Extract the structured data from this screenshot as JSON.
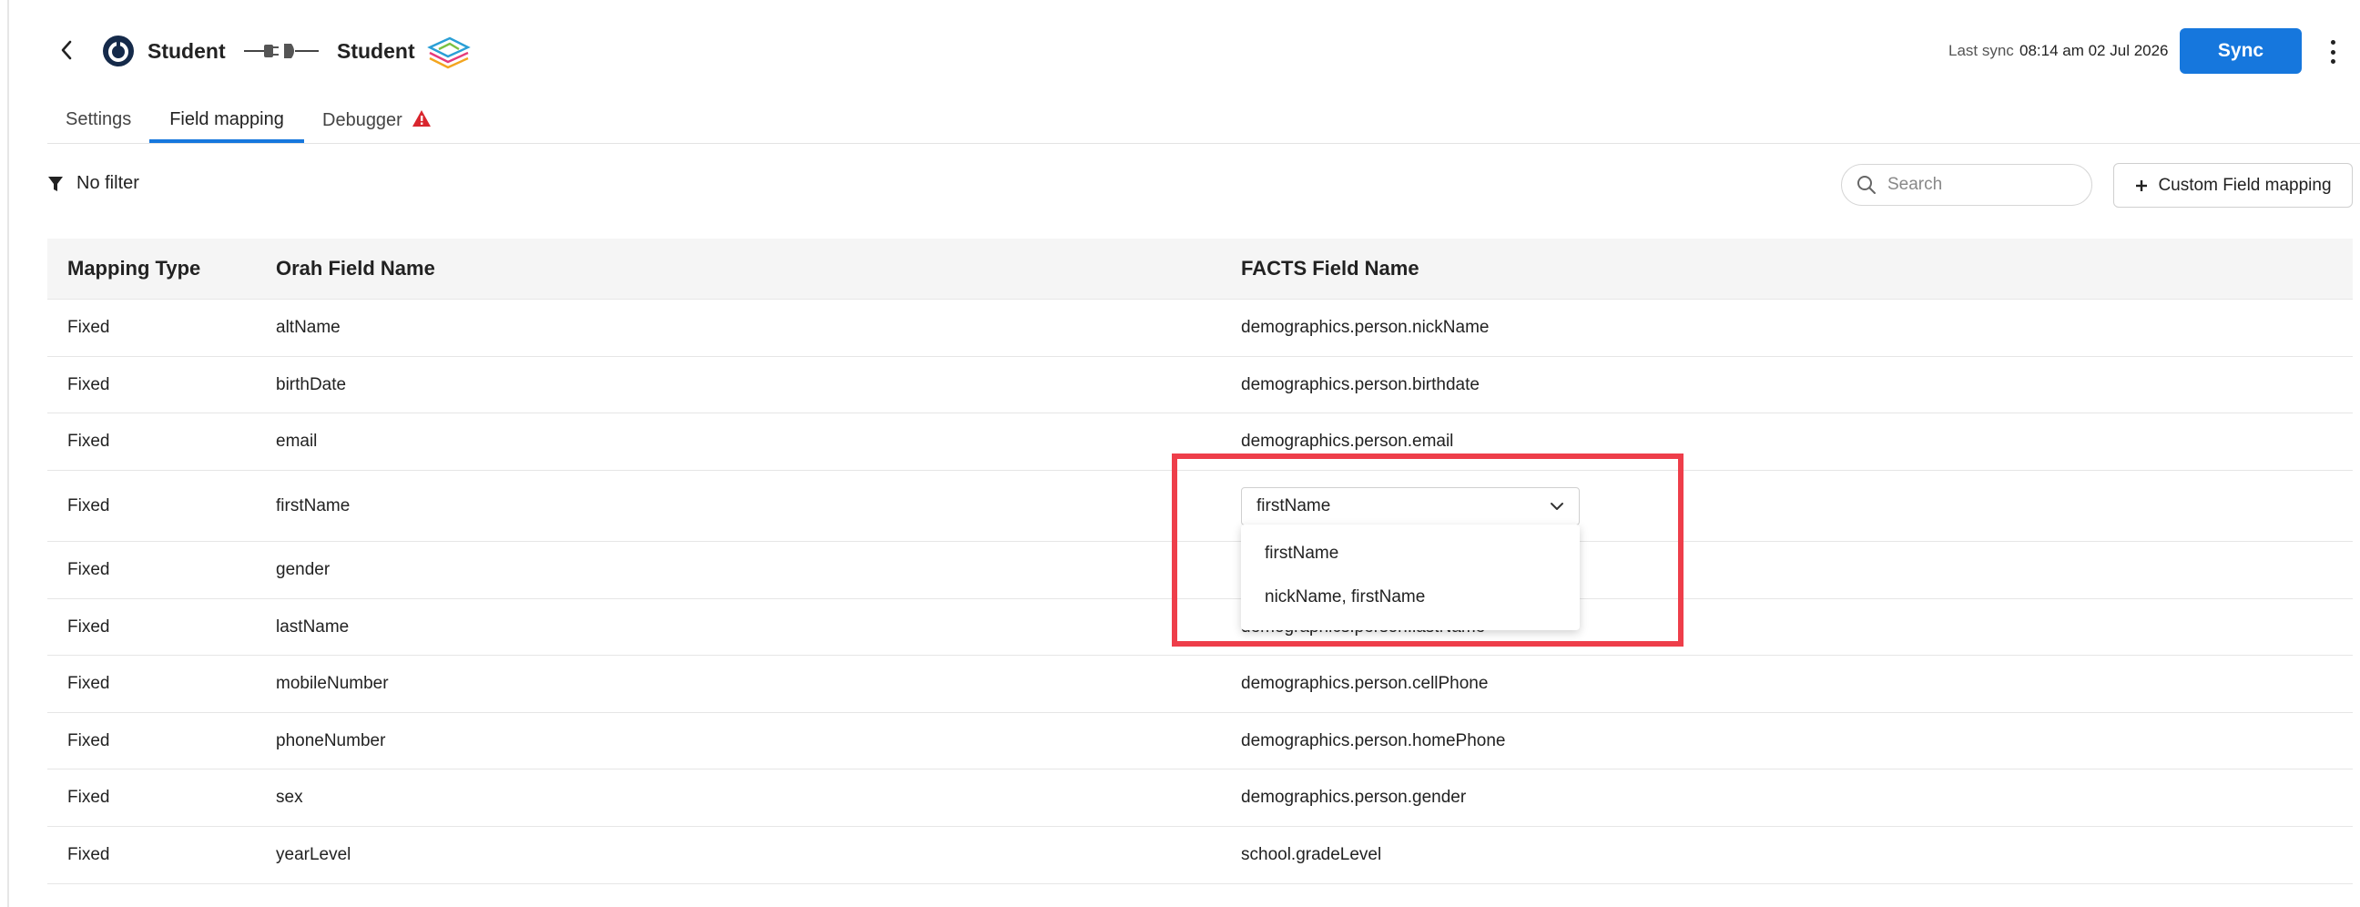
{
  "header": {
    "source_name": "Student",
    "destination_name": "Student",
    "last_sync_label": "Last sync",
    "last_sync_value": "08:14 am 02 Jul 2026",
    "sync_label": "Sync"
  },
  "tabs": [
    {
      "label": "Settings",
      "active": false
    },
    {
      "label": "Field mapping",
      "active": true
    },
    {
      "label": "Debugger",
      "active": false,
      "warning": true
    }
  ],
  "filter": {
    "label": "No filter"
  },
  "search": {
    "placeholder": "Search",
    "value": ""
  },
  "custom_mapping": {
    "label": "Custom Field mapping"
  },
  "table": {
    "columns": [
      "Mapping Type",
      "Orah Field Name",
      "FACTS Field Name"
    ],
    "rows": [
      {
        "type": "Fixed",
        "orah": "altName",
        "facts": "demographics.person.nickName"
      },
      {
        "type": "Fixed",
        "orah": "birthDate",
        "facts": "demographics.person.birthdate"
      },
      {
        "type": "Fixed",
        "orah": "email",
        "facts": "demographics.person.email"
      },
      {
        "type": "Fixed",
        "orah": "firstName",
        "facts": "firstName"
      },
      {
        "type": "Fixed",
        "orah": "gender",
        "facts": ""
      },
      {
        "type": "Fixed",
        "orah": "lastName",
        "facts": "demographics.person.lastName"
      },
      {
        "type": "Fixed",
        "orah": "mobileNumber",
        "facts": "demographics.person.cellPhone"
      },
      {
        "type": "Fixed",
        "orah": "phoneNumber",
        "facts": "demographics.person.homePhone"
      },
      {
        "type": "Fixed",
        "orah": "sex",
        "facts": "demographics.person.gender"
      },
      {
        "type": "Fixed",
        "orah": "yearLevel",
        "facts": "school.gradeLevel"
      }
    ]
  },
  "dropdown": {
    "selected": "firstName",
    "options": [
      "firstName",
      "nickName, firstName"
    ]
  },
  "colors": {
    "accent": "#1677dd",
    "highlight": "#ee3e4a",
    "warning": "#d9262e"
  }
}
